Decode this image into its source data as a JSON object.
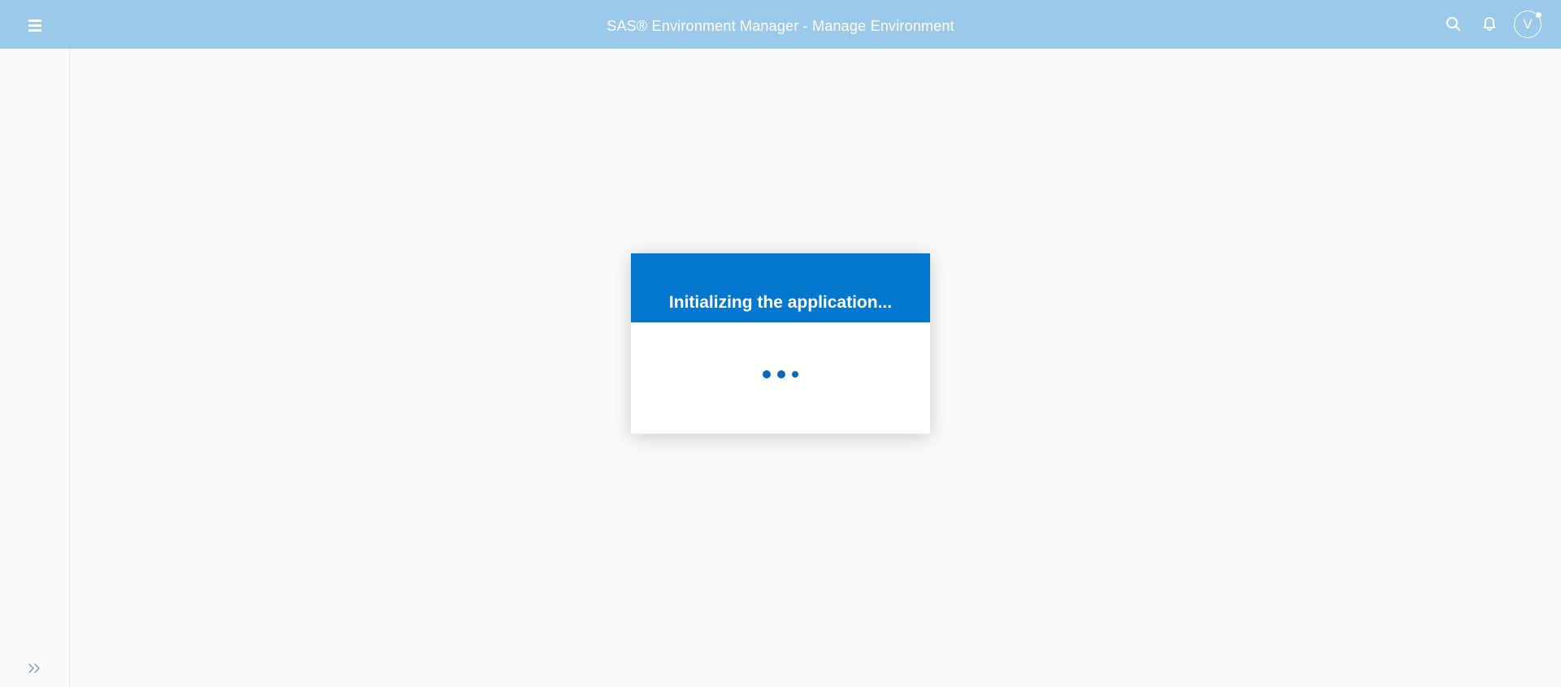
{
  "header": {
    "title": "SAS® Environment Manager - Manage Environment",
    "user_initial": "V",
    "icons": {
      "menu": "menu-icon",
      "search": "search-icon",
      "notifications": "bell-icon",
      "expand": "double-chevron-right-icon"
    }
  },
  "loading": {
    "message": "Initializing the application..."
  },
  "colors": {
    "topbar": "#9bc9ea",
    "dialog_header": "#0478cf",
    "dots": "#0a69b6"
  }
}
